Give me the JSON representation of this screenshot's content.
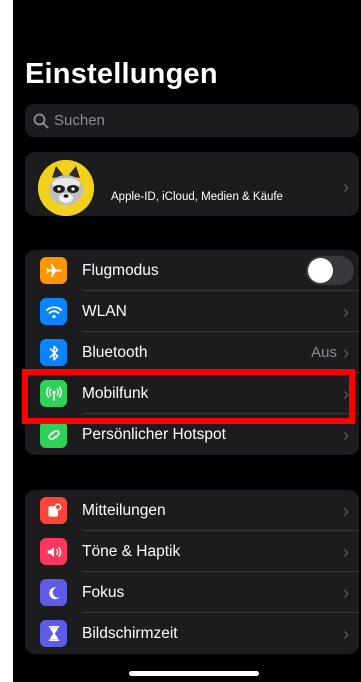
{
  "header": {
    "title": "Einstellungen"
  },
  "search": {
    "placeholder": "Suchen",
    "icon": "search-icon"
  },
  "profile": {
    "subtitle": "Apple-ID, iCloud, Medien & Käufe",
    "avatar": "raccoon-avatar"
  },
  "connectivity": [
    {
      "label": "Flugmodus",
      "icon": "airplane-icon",
      "color": "#ff9500",
      "control": "toggle",
      "toggle_on": false
    },
    {
      "label": "WLAN",
      "icon": "wifi-icon",
      "color": "#0a84ff",
      "control": "chevron"
    },
    {
      "label": "Bluetooth",
      "icon": "bluetooth-icon",
      "color": "#0a84ff",
      "value": "Aus",
      "control": "chevron"
    },
    {
      "label": "Mobilfunk",
      "icon": "antenna-icon",
      "color": "#30d158",
      "control": "chevron",
      "highlighted": true
    },
    {
      "label": "Persönlicher Hotspot",
      "icon": "hotspot-icon",
      "color": "#30d158",
      "control": "chevron"
    }
  ],
  "notifications": [
    {
      "label": "Mitteilungen",
      "icon": "notification-icon",
      "color": "#ff453a"
    },
    {
      "label": "Töne & Haptik",
      "icon": "speaker-icon",
      "color": "#ff375f"
    },
    {
      "label": "Fokus",
      "icon": "moon-icon",
      "color": "#5e5ce6"
    },
    {
      "label": "Bildschirmzeit",
      "icon": "hourglass-icon",
      "color": "#5e5ce6"
    }
  ],
  "colors": {
    "background": "#000000",
    "cell": "#1c1c1e",
    "highlight": "#ff0000"
  },
  "chevron_glyph": "›"
}
